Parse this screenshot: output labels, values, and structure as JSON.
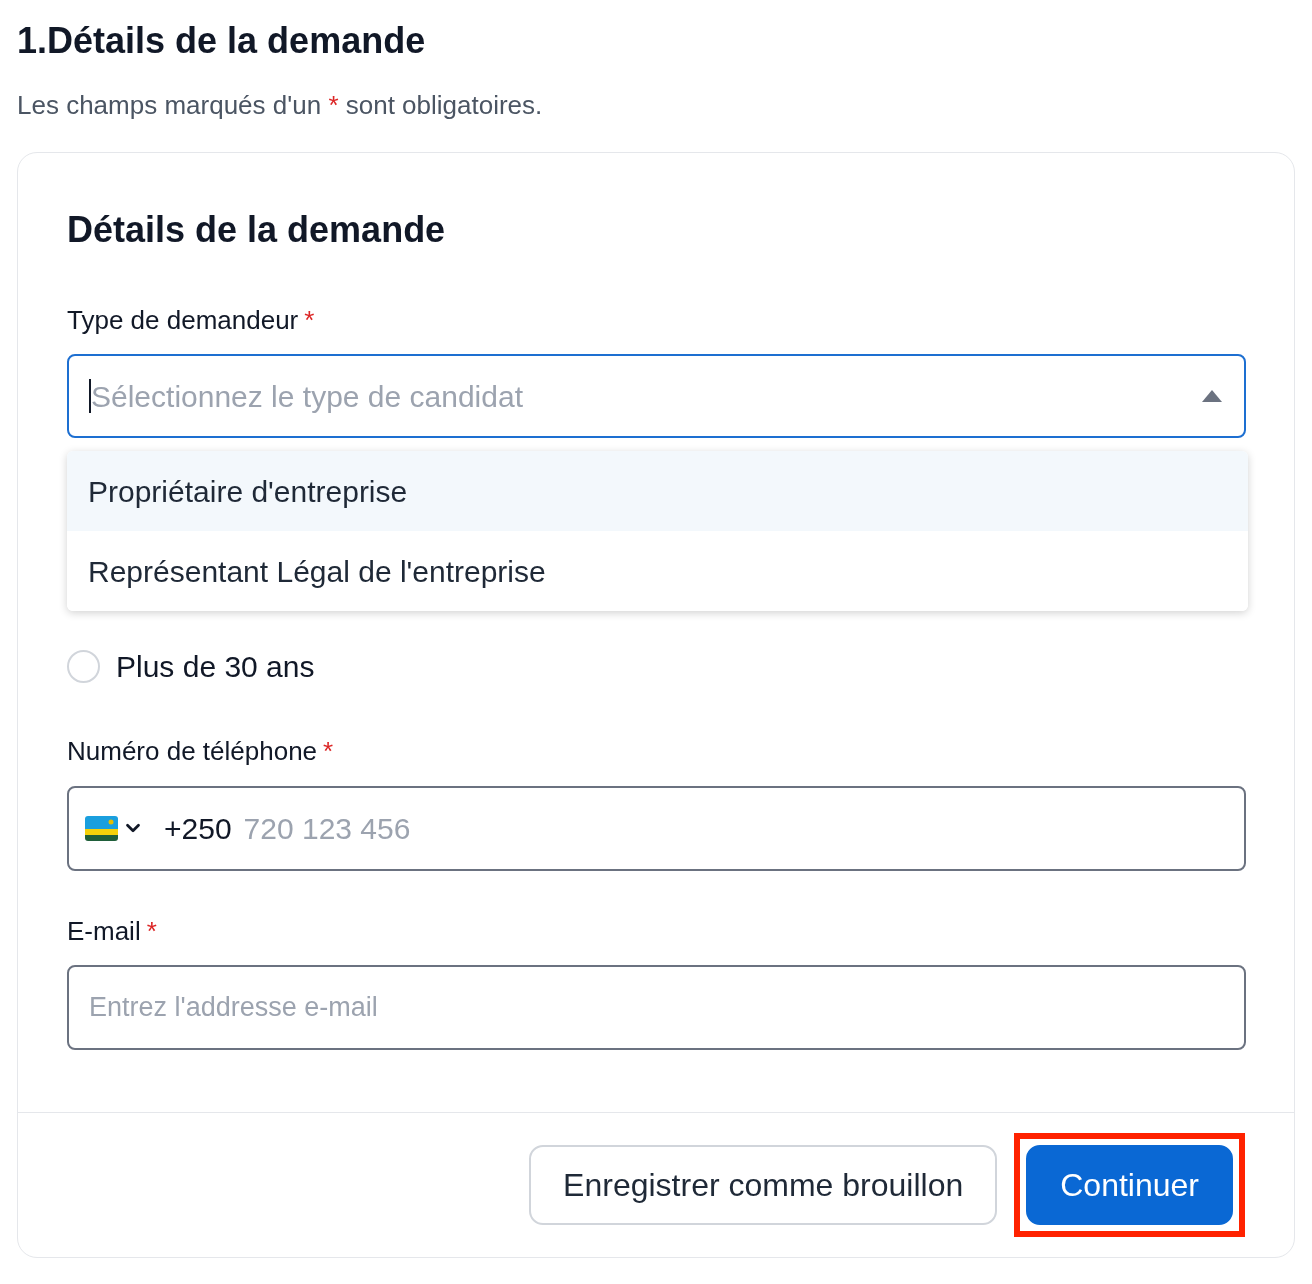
{
  "page_title": "1.Détails de la demande",
  "required_note": {
    "before": "Les champs marqués d'un",
    "mark": "*",
    "after": "sont obligatoires."
  },
  "card": {
    "title": "Détails de la demande",
    "applicant_type": {
      "label": "Type de demandeur",
      "required_mark": "*",
      "placeholder": "Sélectionnez le type de candidat",
      "expanded": true,
      "options": [
        {
          "label": "Propriétaire d'entreprise",
          "highlighted": true
        },
        {
          "label": "Représentant Légal de l'entreprise",
          "highlighted": false
        }
      ]
    },
    "age_options": [
      {
        "label": "Plus de 30 ans",
        "selected": false
      }
    ],
    "phone": {
      "label": "Numéro de téléphone",
      "required_mark": "*",
      "dial_code": "+250",
      "placeholder": "720 123 456"
    },
    "email": {
      "label": "E-mail",
      "required_mark": "*",
      "placeholder": "Entrez l'addresse e-mail"
    },
    "buttons": [
      {
        "label": "Enregistrer comme brouillon",
        "kind": "secondary",
        "highlighted": false
      },
      {
        "label": "Continuer",
        "kind": "primary",
        "highlighted": true
      }
    ]
  }
}
